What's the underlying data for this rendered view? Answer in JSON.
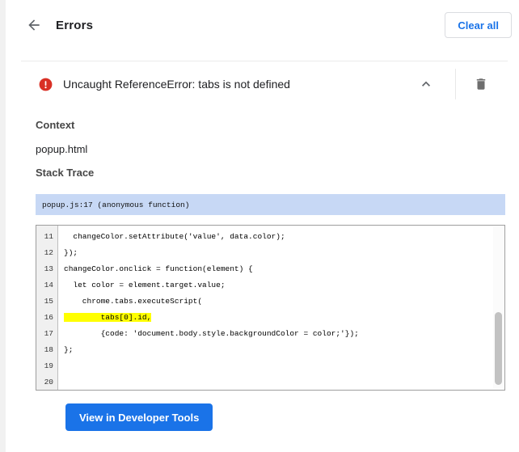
{
  "header": {
    "title": "Errors",
    "clear_all_label": "Clear all"
  },
  "error_entry": {
    "message": "Uncaught ReferenceError: tabs is not defined"
  },
  "details": {
    "context_heading": "Context",
    "context_value": "popup.html",
    "stack_trace_heading": "Stack Trace",
    "stack_frame": "popup.js:17 (anonymous function)"
  },
  "code_viewer": {
    "lines": [
      {
        "num": "11",
        "text": "  changeColor.setAttribute('value', data.color);",
        "highlighted": false
      },
      {
        "num": "12",
        "text": "});",
        "highlighted": false
      },
      {
        "num": "13",
        "text": "",
        "highlighted": false
      },
      {
        "num": "14",
        "text": "changeColor.onclick = function(element) {",
        "highlighted": false
      },
      {
        "num": "15",
        "text": "  let color = element.target.value;",
        "highlighted": false
      },
      {
        "num": "16",
        "text": "    chrome.tabs.executeScript(",
        "highlighted": false
      },
      {
        "num": "17",
        "text": "        tabs[0].id,",
        "highlighted": true
      },
      {
        "num": "18",
        "text": "        {code: 'document.body.style.backgroundColor = color;'});",
        "highlighted": false
      },
      {
        "num": "19",
        "text": "};",
        "highlighted": false
      },
      {
        "num": "20",
        "text": "",
        "highlighted": false
      }
    ]
  },
  "footer": {
    "view_in_devtools_label": "View in Developer Tools"
  },
  "colors": {
    "accent_blue": "#1a73e8",
    "error_red": "#d93025",
    "stack_frame_bg": "#c7d8f5",
    "highlight_yellow": "#ffff00"
  }
}
